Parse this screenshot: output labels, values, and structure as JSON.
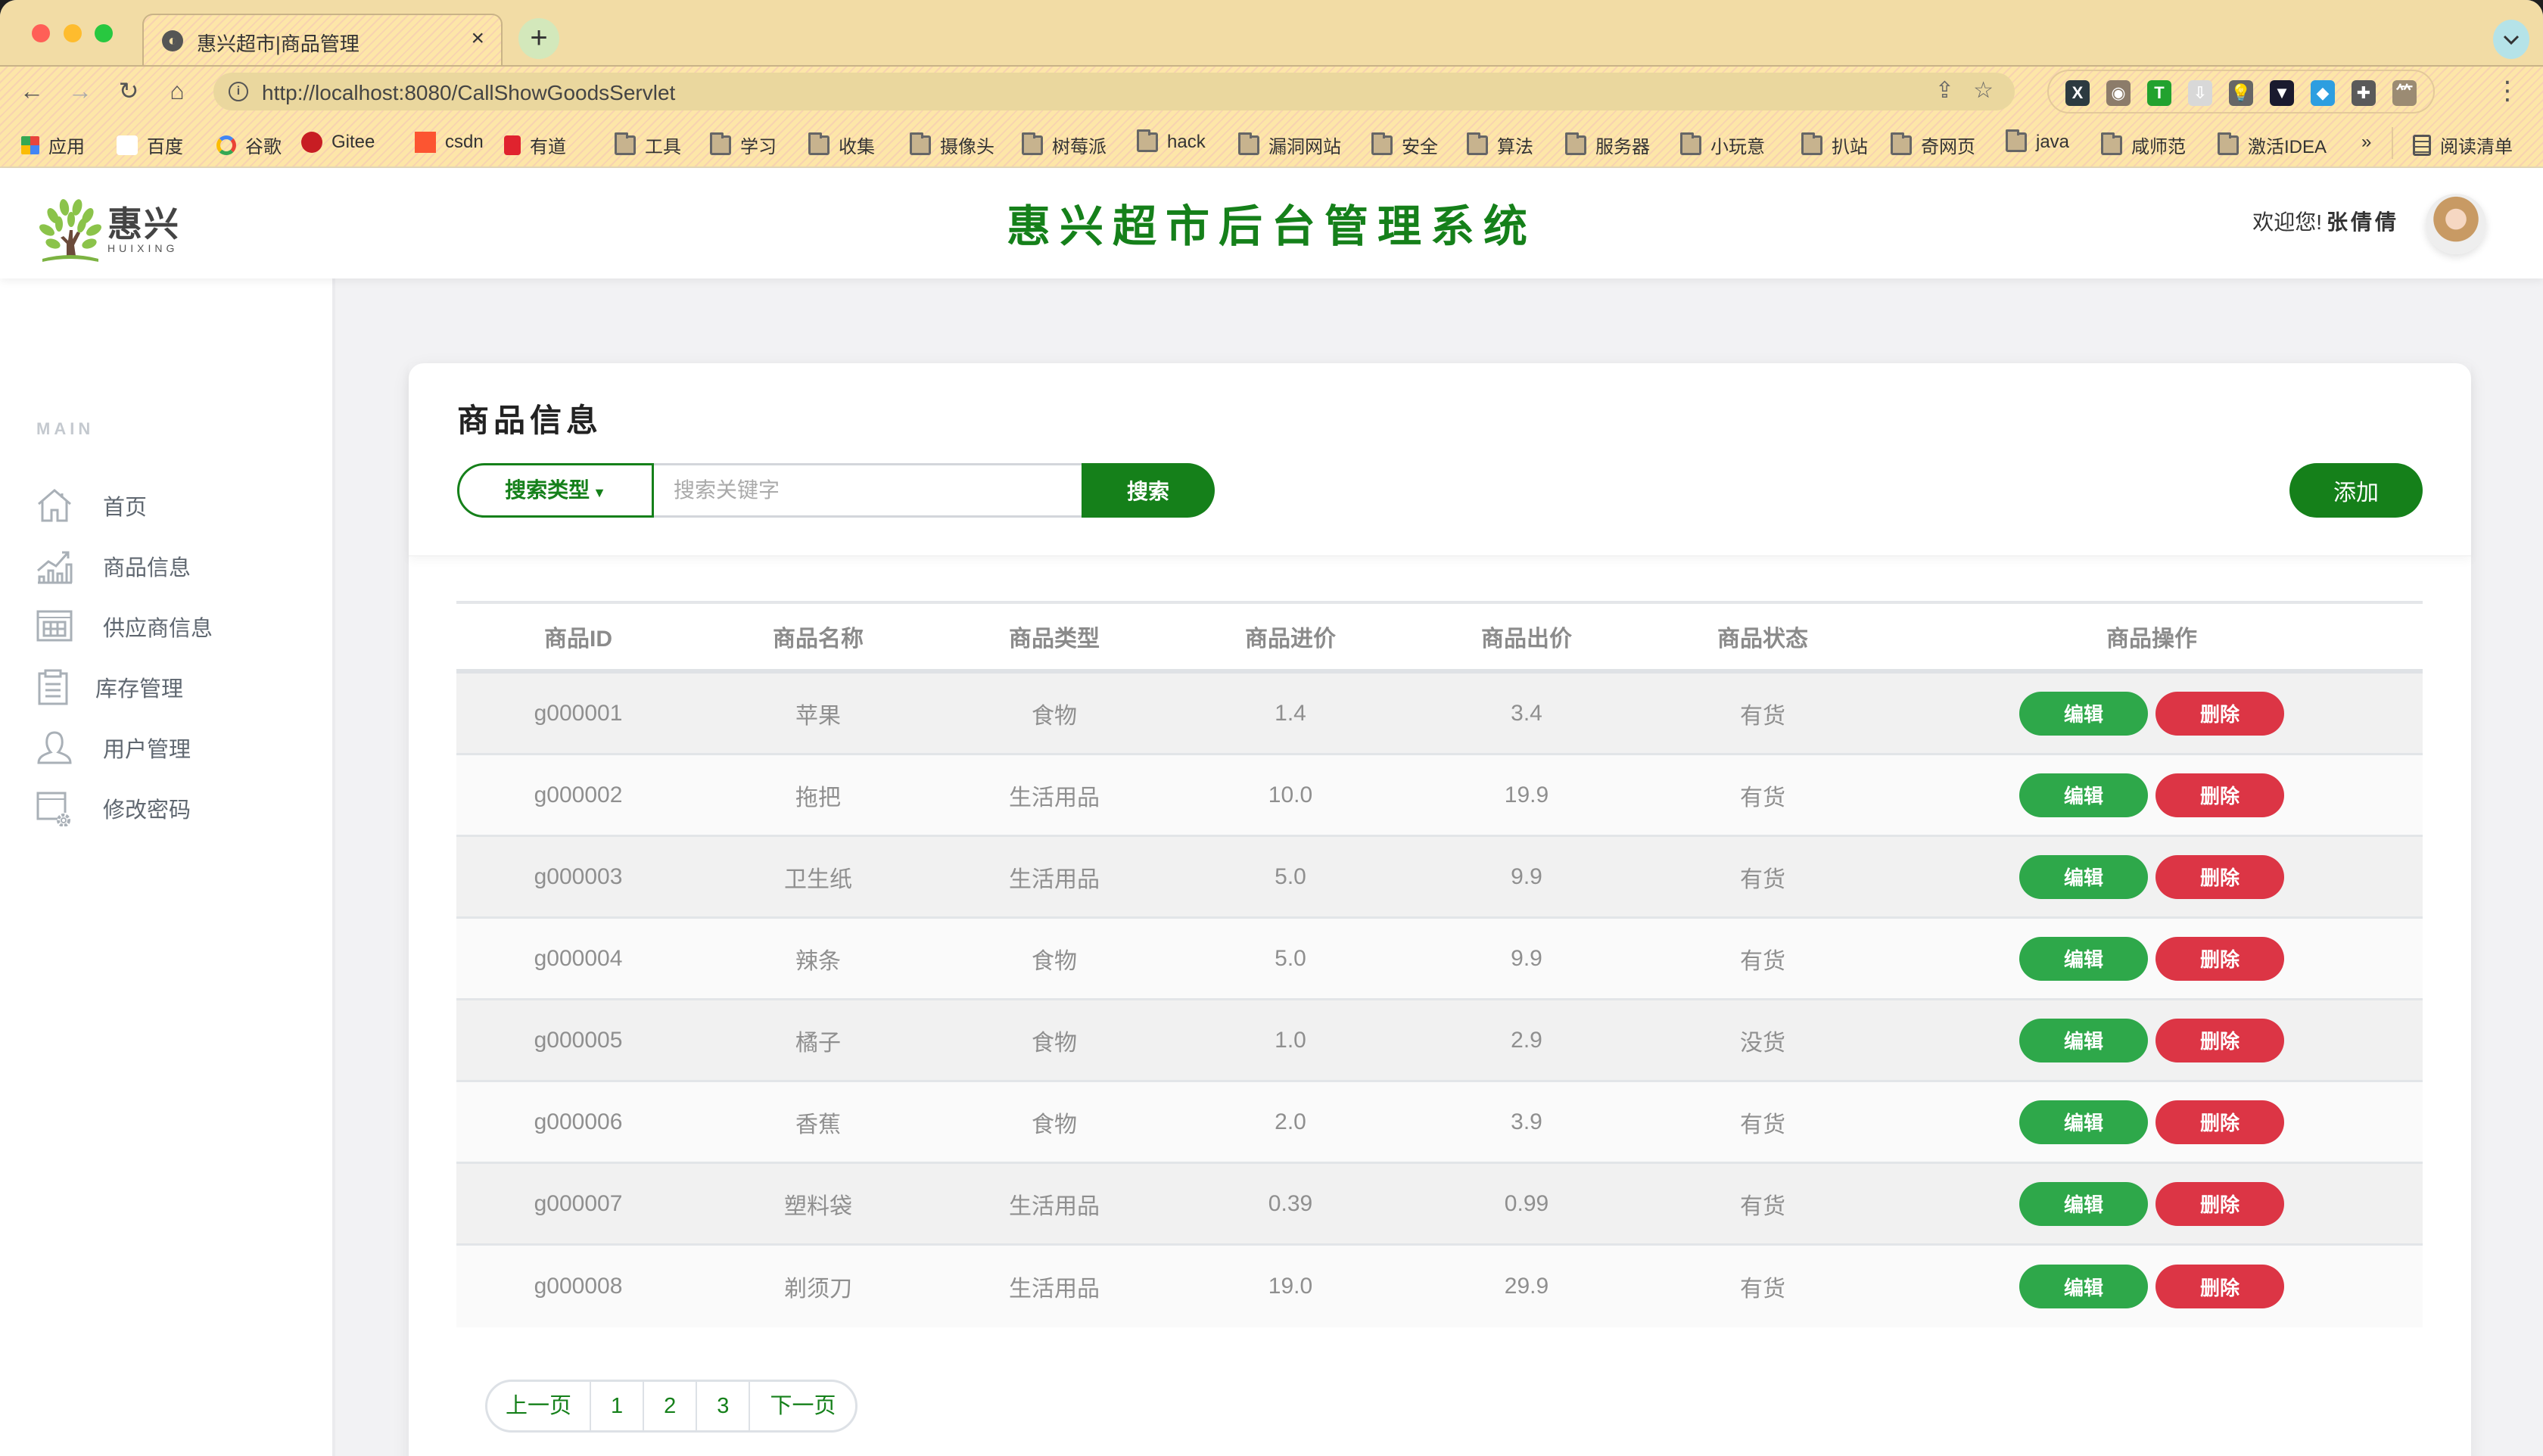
{
  "browser": {
    "tab_title": "惠兴超市|商品管理",
    "tab_close": "×",
    "new_tab": "+",
    "tabs_menu": "⌄",
    "url": "http://localhost:8080/CallShowGoodsServlet",
    "nav": {
      "back": "←",
      "forward": "→",
      "reload": "↻",
      "home": "⌂"
    },
    "omni_icons": {
      "share": "⇪",
      "bookmark": "☆"
    },
    "extensions": [
      {
        "name": "x-extension",
        "glyph": "X",
        "color": "#2c3a40"
      },
      {
        "name": "eyes-extension",
        "glyph": "◉",
        "color": "#8c7c6a"
      },
      {
        "name": "t-shield-extension",
        "glyph": "T",
        "color": "#22a22e"
      },
      {
        "name": "folder-download-extension",
        "glyph": "⇩",
        "color": "#d8d8d8"
      },
      {
        "name": "bulb-extension",
        "glyph": "💡",
        "color": "#666666"
      },
      {
        "name": "bookmark-extension",
        "glyph": "▼",
        "color": "#1a1a2e"
      },
      {
        "name": "tag-extension",
        "glyph": "◆",
        "color": "#2d9ee0"
      },
      {
        "name": "puzzle-extension",
        "glyph": "✚",
        "color": "#5a5a5a"
      },
      {
        "name": "branch-extension",
        "glyph": "⺮",
        "color": "#9b8b73"
      }
    ],
    "kebab": "⋮",
    "bookmarks": [
      {
        "label": "应用",
        "icon": "apps-grid-icon"
      },
      {
        "label": "百度",
        "icon": "baidu-icon"
      },
      {
        "label": "谷歌",
        "icon": "google-icon"
      },
      {
        "label": "Gitee",
        "icon": "gitee-icon"
      },
      {
        "label": "csdn",
        "icon": "csdn-icon"
      },
      {
        "label": "有道",
        "icon": "youdao-icon"
      },
      {
        "label": "工具",
        "icon": "folder-icon"
      },
      {
        "label": "学习",
        "icon": "folder-icon"
      },
      {
        "label": "收集",
        "icon": "folder-icon"
      },
      {
        "label": "摄像头",
        "icon": "folder-icon"
      },
      {
        "label": "树莓派",
        "icon": "folder-icon"
      },
      {
        "label": "hack",
        "icon": "folder-icon"
      },
      {
        "label": "漏洞网站",
        "icon": "folder-icon"
      },
      {
        "label": "安全",
        "icon": "folder-icon"
      },
      {
        "label": "算法",
        "icon": "folder-icon"
      },
      {
        "label": "服务器",
        "icon": "folder-icon"
      },
      {
        "label": "小玩意",
        "icon": "folder-icon"
      },
      {
        "label": "扒站",
        "icon": "folder-icon"
      },
      {
        "label": "奇网页",
        "icon": "folder-icon"
      },
      {
        "label": "java",
        "icon": "folder-icon"
      },
      {
        "label": "咸师范",
        "icon": "folder-icon"
      },
      {
        "label": "激活IDEA",
        "icon": "folder-icon"
      }
    ],
    "bookmarks_overflow": "»",
    "reading_list": "阅读清单"
  },
  "header": {
    "logo_text": "惠兴",
    "logo_sub": "HUIXING",
    "title": "惠兴超市后台管理系统",
    "welcome": "欢迎您!",
    "user_name": "张倩倩"
  },
  "sidebar": {
    "section_label": "MAIN",
    "items": [
      {
        "label": "首页",
        "icon": "home-icon"
      },
      {
        "label": "商品信息",
        "icon": "chart-icon"
      },
      {
        "label": "供应商信息",
        "icon": "calendar-grid-icon"
      },
      {
        "label": "库存管理",
        "icon": "clipboard-icon"
      },
      {
        "label": "用户管理",
        "icon": "user-icon"
      },
      {
        "label": "修改密码",
        "icon": "window-gear-icon"
      }
    ]
  },
  "main": {
    "card_title": "商品信息",
    "search_type_label": "搜索类型",
    "search_placeholder": "搜索关键字",
    "search_value": "",
    "search_button": "搜索",
    "add_button": "添加",
    "columns": [
      "商品ID",
      "商品名称",
      "商品类型",
      "商品进价",
      "商品出价",
      "商品状态",
      "商品操作"
    ],
    "edit_label": "编辑",
    "delete_label": "删除",
    "rows": [
      {
        "id": "g000001",
        "name": "苹果",
        "type": "食物",
        "cost": "1.4",
        "price": "3.4",
        "status": "有货"
      },
      {
        "id": "g000002",
        "name": "拖把",
        "type": "生活用品",
        "cost": "10.0",
        "price": "19.9",
        "status": "有货"
      },
      {
        "id": "g000003",
        "name": "卫生纸",
        "type": "生活用品",
        "cost": "5.0",
        "price": "9.9",
        "status": "有货"
      },
      {
        "id": "g000004",
        "name": "辣条",
        "type": "食物",
        "cost": "5.0",
        "price": "9.9",
        "status": "有货"
      },
      {
        "id": "g000005",
        "name": "橘子",
        "type": "食物",
        "cost": "1.0",
        "price": "2.9",
        "status": "没货"
      },
      {
        "id": "g000006",
        "name": "香蕉",
        "type": "食物",
        "cost": "2.0",
        "price": "3.9",
        "status": "有货"
      },
      {
        "id": "g000007",
        "name": "塑料袋",
        "type": "生活用品",
        "cost": "0.39",
        "price": "0.99",
        "status": "有货"
      },
      {
        "id": "g000008",
        "name": "剃须刀",
        "type": "生活用品",
        "cost": "19.0",
        "price": "29.9",
        "status": "有货"
      }
    ],
    "pagination": {
      "prev": "上一页",
      "pages": [
        "1",
        "2",
        "3"
      ],
      "next": "下一页"
    }
  },
  "colors": {
    "brand_green": "#15801a",
    "edit_green": "#2ea84a",
    "delete_red": "#dc3545"
  }
}
